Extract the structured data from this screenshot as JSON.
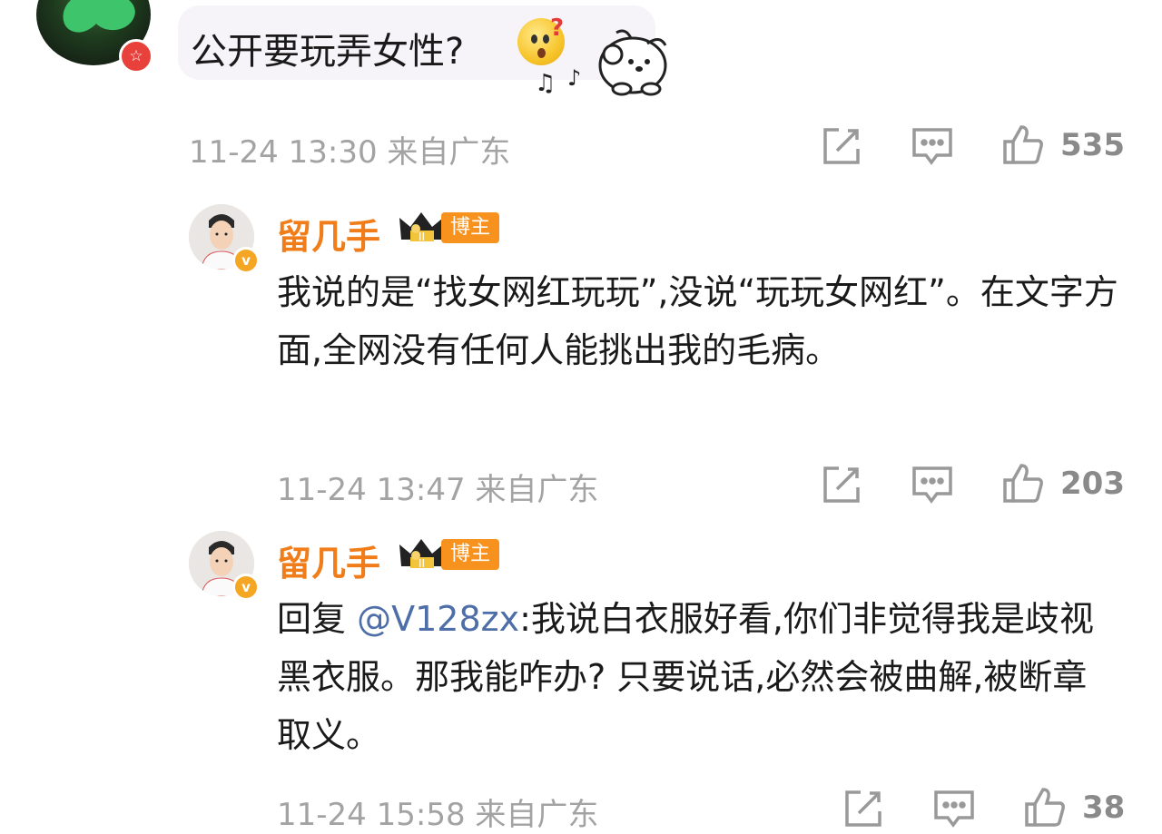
{
  "top_comment": {
    "text": "公开要玩弄女性?",
    "timestamp": "11-24 13:30",
    "location": "来自广东",
    "like_count": "535"
  },
  "replies": [
    {
      "username": "留几手",
      "role_badge": "博主",
      "text": "我说的是“找女网红玩玩”,没说“玩玩女网红”。在文字方面,全网没有任何人能挑出我的毛病。",
      "timestamp": "11-24 13:47",
      "location": "来自广东",
      "like_count": "203"
    },
    {
      "username": "留几手",
      "role_badge": "博主",
      "reply_prefix": "回复 ",
      "mention": "@V128zx",
      "text": ":我说白衣服好看,你们非觉得我是歧视黑衣服。那我能咋办? 只要说话,必然会被曲解,被断章取义。",
      "timestamp": "11-24 15:58",
      "location": "来自广东",
      "like_count": "38"
    }
  ],
  "icons": [
    "share-icon",
    "comment-icon",
    "like-icon",
    "verified-icon",
    "crown-icon",
    "emoji-icon",
    "sticker-icon"
  ],
  "colors": {
    "username": "#f07d1a",
    "mention": "#4d6ea8",
    "meta": "#a3a3a3",
    "badge": "#f7921e"
  }
}
